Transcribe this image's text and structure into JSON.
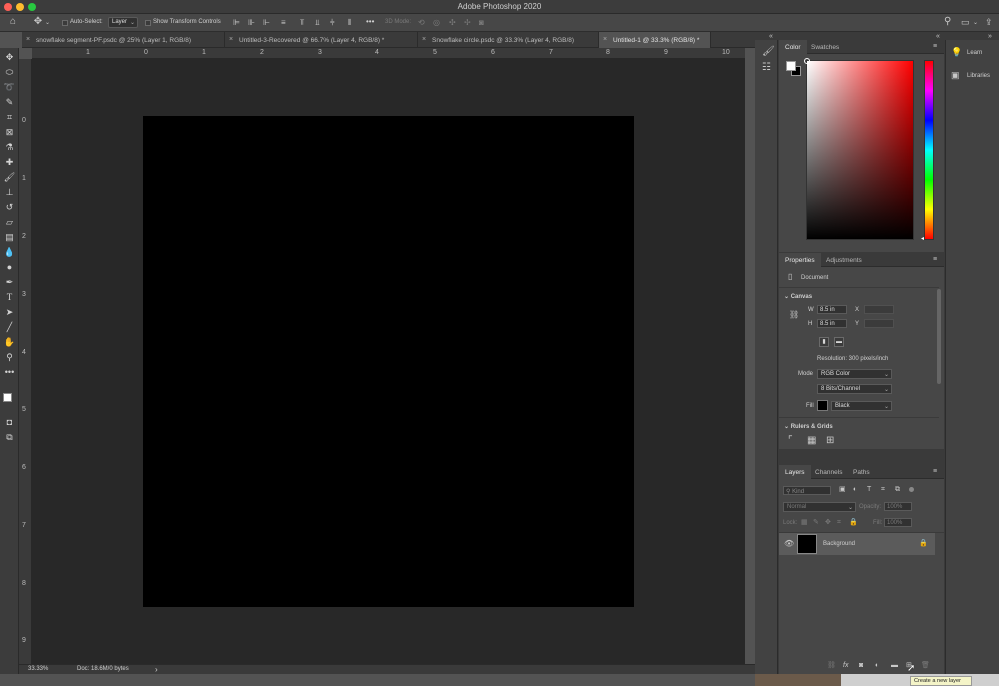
{
  "window": {
    "title": "Adobe Photoshop 2020",
    "colors": {
      "close": "#fe5f57",
      "minimize": "#febc2e",
      "zoom": "#28c840"
    }
  },
  "options_bar": {
    "home_icon": "home-icon",
    "move_tool_icon": "move-tool-icon",
    "auto_select_label": "Auto-Select:",
    "auto_select_value": "Layer",
    "show_transform_label": "Show Transform Controls",
    "more_label": "•••",
    "mode_3d_label": "3D Mode:"
  },
  "tabs": [
    {
      "label": "snowflake segment-PF.psdc @ 25% (Layer 1, RGB/8)",
      "cloud": true,
      "active": false
    },
    {
      "label": "Untitled-3-Recovered @ 66.7% (Layer 4, RGB/8) *",
      "cloud": false,
      "active": false
    },
    {
      "label": "Snowflake circle.psdc @ 33.3% (Layer 4, RGB/8)",
      "cloud": true,
      "active": false
    },
    {
      "label": "Untitled-1 @ 33.3% (RGB/8) *",
      "cloud": false,
      "active": true
    }
  ],
  "rulers": {
    "horizontal": [
      "1",
      "0",
      "1",
      "2",
      "3",
      "4",
      "5",
      "6",
      "7",
      "8",
      "9",
      "10"
    ],
    "vertical": [
      "0",
      "1",
      "2",
      "3",
      "4",
      "5",
      "6",
      "7",
      "8",
      "9"
    ]
  },
  "canvas": {
    "fill_color": "#000000",
    "workspace_color": "#282828"
  },
  "status": {
    "zoom": "33.33%",
    "doc": "Doc: 18.6M/0 bytes",
    "arrow": "›"
  },
  "color_panel": {
    "tabs": [
      "Color",
      "Swatches"
    ],
    "foreground": "#ffffff",
    "background": "#000000",
    "hue": "#ff0000"
  },
  "properties_panel": {
    "tabs": [
      "Properties",
      "Adjustments"
    ],
    "document_label": "Document",
    "canvas_section": "Canvas",
    "w_label": "W",
    "w_value": "8.5 in",
    "h_label": "H",
    "h_value": "8.5 in",
    "x_label": "X",
    "y_label": "Y",
    "resolution": "Resolution: 300 pixels/inch",
    "mode_label": "Mode",
    "mode_value": "RGB Color",
    "bits_value": "8 Bits/Channel",
    "fill_label": "Fill",
    "fill_value": "Black",
    "rulers_section": "Rulers & Grids"
  },
  "layers_panel": {
    "tabs": [
      "Layers",
      "Channels",
      "Paths"
    ],
    "kind_placeholder": "Kind",
    "blend_mode": "Normal",
    "opacity_label": "Opacity:",
    "opacity_value": "100%",
    "lock_label": "Lock:",
    "fill_label": "Fill:",
    "fill_value": "100%",
    "layers": [
      {
        "name": "Background",
        "visible": true,
        "locked": true
      }
    ]
  },
  "right_strip": {
    "learn": "Learn",
    "libraries": "Libraries"
  },
  "tooltip": "Create a new layer"
}
